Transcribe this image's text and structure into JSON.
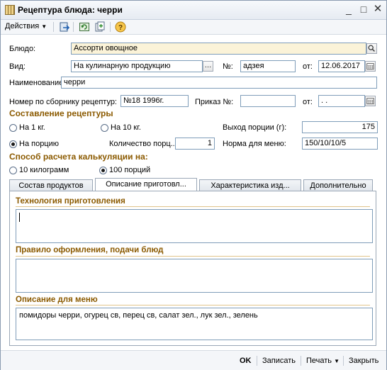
{
  "window": {
    "title": "Рецептура блюда: черри"
  },
  "toolbar": {
    "actions_label": "Действия",
    "help_glyph": "?"
  },
  "form": {
    "dish_label": "Блюдо:",
    "dish_value": "Ассорти овощное",
    "kind_label": "Вид:",
    "kind_value": "На кулинарную продукцию",
    "number_label": "№:",
    "number_value": "адзея",
    "from_label": "от:",
    "from_value": "12.06.2017",
    "name_label": "Наименование:",
    "name_value": "черри",
    "collection_label": "Номер по сборнику рецептур:",
    "collection_value": "№18 1996г.",
    "order_label": "Приказ №:",
    "order_value": "",
    "order_from_label": "от:",
    "order_from_value": " .  .",
    "compose_section": "Составление рецептуры",
    "radio_1kg": "На 1 кг.",
    "radio_10kg": "На 10 кг.",
    "yield_label": "Выход порции (г):",
    "yield_value": "175",
    "radio_portion": "На порцию",
    "portions_label": "Количество порц...",
    "portions_value": "1",
    "menu_norm_label": "Норма для меню:",
    "menu_norm_value": "150/10/10/5",
    "calc_section": "Способ расчета калькуляции на:",
    "radio_10kilo": "10 килограмм",
    "radio_100": "100 порций"
  },
  "tabs": [
    "Состав продуктов",
    "Описание приготовл...",
    "Характеристика изд...",
    "Дополнительно"
  ],
  "panel": {
    "tech_title": "Технология приготовления",
    "tech_text": "",
    "serve_title": "Правило оформления, подачи блюд",
    "serve_text": "",
    "menu_title": "Описание для меню",
    "menu_text": "помидоры черри, огурец св, перец св, салат зел., лук зел., зелень"
  },
  "bottom": {
    "ok": "OK",
    "save": "Записать",
    "print": "Печать",
    "close": "Закрыть"
  }
}
